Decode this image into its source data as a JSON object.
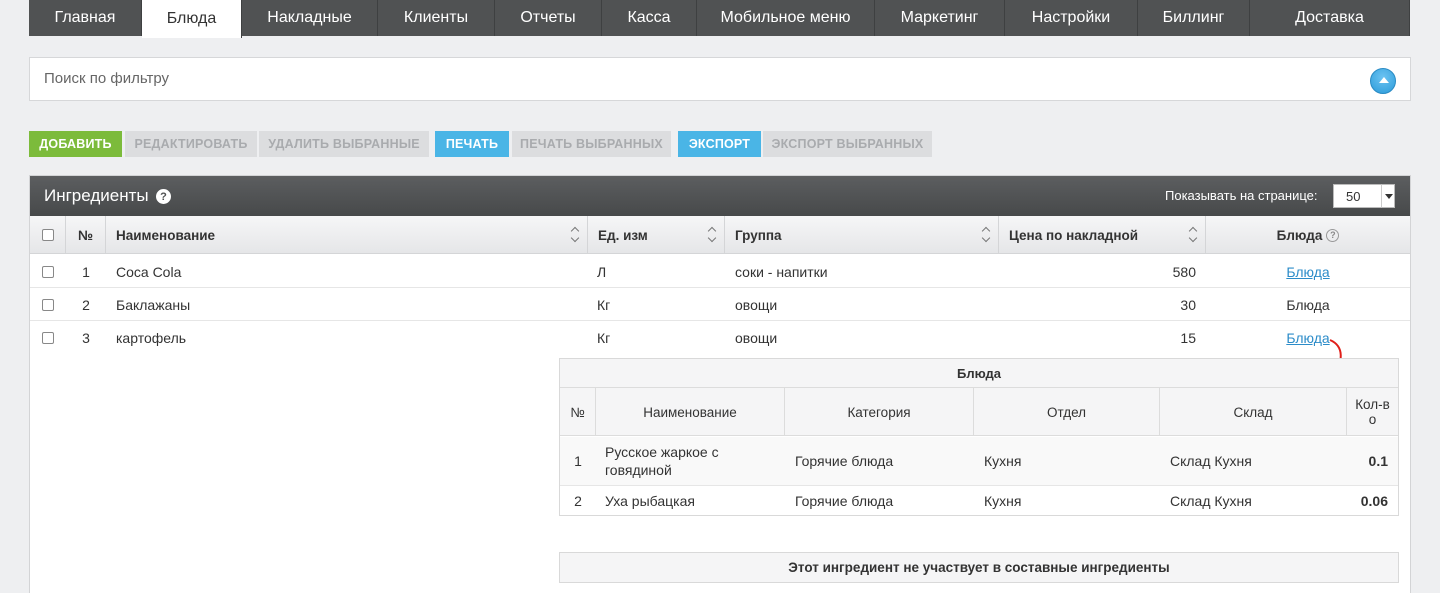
{
  "nav": {
    "tabs": [
      "Главная",
      "Блюда",
      "Накладные",
      "Клиенты",
      "Отчеты",
      "Касса",
      "Мобильное меню",
      "Маркетинг",
      "Настройки",
      "Биллинг",
      "Доставка"
    ],
    "active_tab": "Блюда"
  },
  "filter": {
    "label": "Поиск по фильтру",
    "toggle_icon": "chevron-up-icon"
  },
  "actions": {
    "add": "ДОБАВИТЬ",
    "edit": "РЕДАКТИРОВАТЬ",
    "delete_selected": "УДАЛИТЬ ВЫБРАННЫЕ",
    "print": "ПЕЧАТЬ",
    "print_selected": "ПЕЧАТЬ ВЫБРАННЫХ",
    "export": "ЭКСПОРТ",
    "export_selected": "ЭКСПОРТ ВЫБРАННЫХ"
  },
  "panel": {
    "title": "Ингредиенты",
    "help_symbol": "?",
    "per_page_label": "Показывать на странице:",
    "per_page_value": "50"
  },
  "table": {
    "headers": {
      "num": "№",
      "name": "Наименование",
      "unit": "Ед. изм",
      "group": "Группа",
      "price": "Цена по накладной",
      "dishes": "Блюда"
    },
    "rows": [
      {
        "num": "1",
        "name": "Coca Cola",
        "unit": "Л",
        "group": "соки - напитки",
        "price": "580",
        "dishes": "Блюда",
        "dishes_link": true
      },
      {
        "num": "2",
        "name": "Баклажаны",
        "unit": "Кг",
        "group": "овощи",
        "price": "30",
        "dishes": "Блюда",
        "dishes_link": false
      },
      {
        "num": "3",
        "name": "картофель",
        "unit": "Кг",
        "group": "овощи",
        "price": "15",
        "dishes": "Блюда",
        "dishes_link": true
      }
    ]
  },
  "subtable": {
    "title": "Блюда",
    "headers": {
      "num": "№",
      "name": "Наименование",
      "category": "Категория",
      "department": "Отдел",
      "warehouse": "Склад",
      "qty": "Кол-во"
    },
    "rows": [
      {
        "num": "1",
        "name": "Русское жаркое с говядиной",
        "category": "Горячие блюда",
        "department": "Кухня",
        "warehouse": "Склад Кухня",
        "qty": "0.1"
      },
      {
        "num": "2",
        "name": "Уха рыбацкая",
        "category": "Горячие блюда",
        "department": "Кухня",
        "warehouse": "Склад Кухня",
        "qty": "0.06"
      }
    ]
  },
  "note": "Этот ингредиент не участвует в составные ингредиенты",
  "colors": {
    "nav_bg": "#505253",
    "green": "#7cbb3b",
    "blue": "#4ab5e6",
    "link": "#2c8cc9",
    "annotation_arrow": "#e0201a"
  }
}
